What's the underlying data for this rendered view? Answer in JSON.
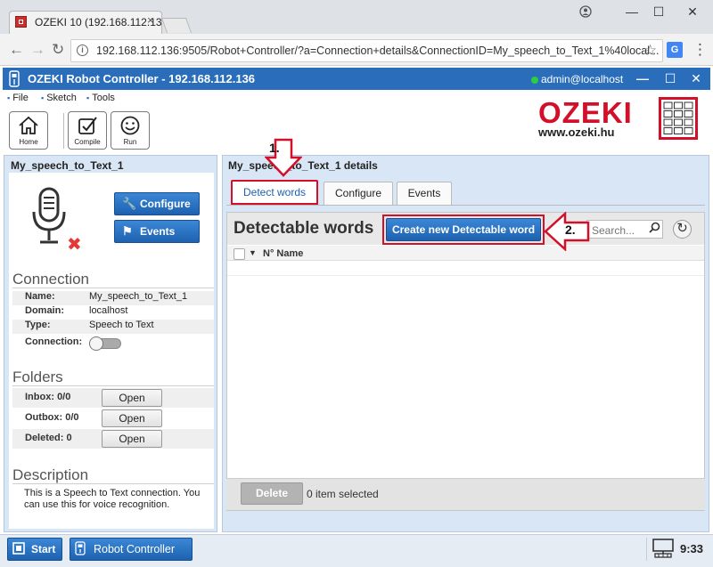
{
  "browser": {
    "tab_title": "OZEKI 10 (192.168.112.13",
    "tab_close": "×",
    "window_minimize": "—",
    "window_maximize": "☐",
    "window_close": "✕",
    "url": "192.168.112.136:9505/Robot+Controller/?a=Connection+details&ConnectionID=My_speech_to_Text_1%40local..."
  },
  "app": {
    "title": "OZEKI Robot Controller - 192.168.112.136",
    "user": "admin@localhost",
    "win_minimize": "—",
    "win_maximize": "☐",
    "win_close": "✕",
    "menu": [
      "File",
      "Sketch",
      "Tools"
    ],
    "toolbar": [
      {
        "label": "Home",
        "icon": "home-icon"
      },
      {
        "label": "Compile",
        "icon": "compile-icon"
      },
      {
        "label": "Run",
        "icon": "run-icon"
      }
    ],
    "logo_text": "OZEKI",
    "logo_url": "www.ozeki.hu",
    "brand_color": "#d3102a",
    "accent_color": "#2a6ebb"
  },
  "left": {
    "title": "My_speech_to_Text_1",
    "configure_label": "Configure",
    "events_label": "Events",
    "connection_head": "Connection",
    "connection": [
      {
        "k": "Name:",
        "v": "My_speech_to_Text_1"
      },
      {
        "k": "Domain:",
        "v": "localhost"
      },
      {
        "k": "Type:",
        "v": "Speech to Text"
      },
      {
        "k": "Connection:",
        "v": ""
      }
    ],
    "folders_head": "Folders",
    "folders": [
      {
        "k": "Inbox:",
        "v": "0/0",
        "btn": "Open"
      },
      {
        "k": "Outbox:",
        "v": "0/0",
        "btn": "Open"
      },
      {
        "k": "Deleted:",
        "v": "0",
        "btn": "Open"
      }
    ],
    "description_head": "Description",
    "description": "This is a Speech to Text connection. You can use this for voice recognition."
  },
  "right": {
    "title": "My_speech_to_Text_1 details",
    "tabs": [
      "Detect words",
      "Configure",
      "Events"
    ],
    "section_title": "Detectable words",
    "create_button": "Create new Detectable word",
    "search_placeholder": "Search...",
    "col_no": "N°",
    "col_name": "Name",
    "delete_label": "Delete",
    "selected_text": "0 item selected",
    "annotation_1": "1.",
    "annotation_2": "2."
  },
  "taskbar": {
    "start_label": "Start",
    "task_label": "Robot Controller",
    "clock": "9:33"
  }
}
